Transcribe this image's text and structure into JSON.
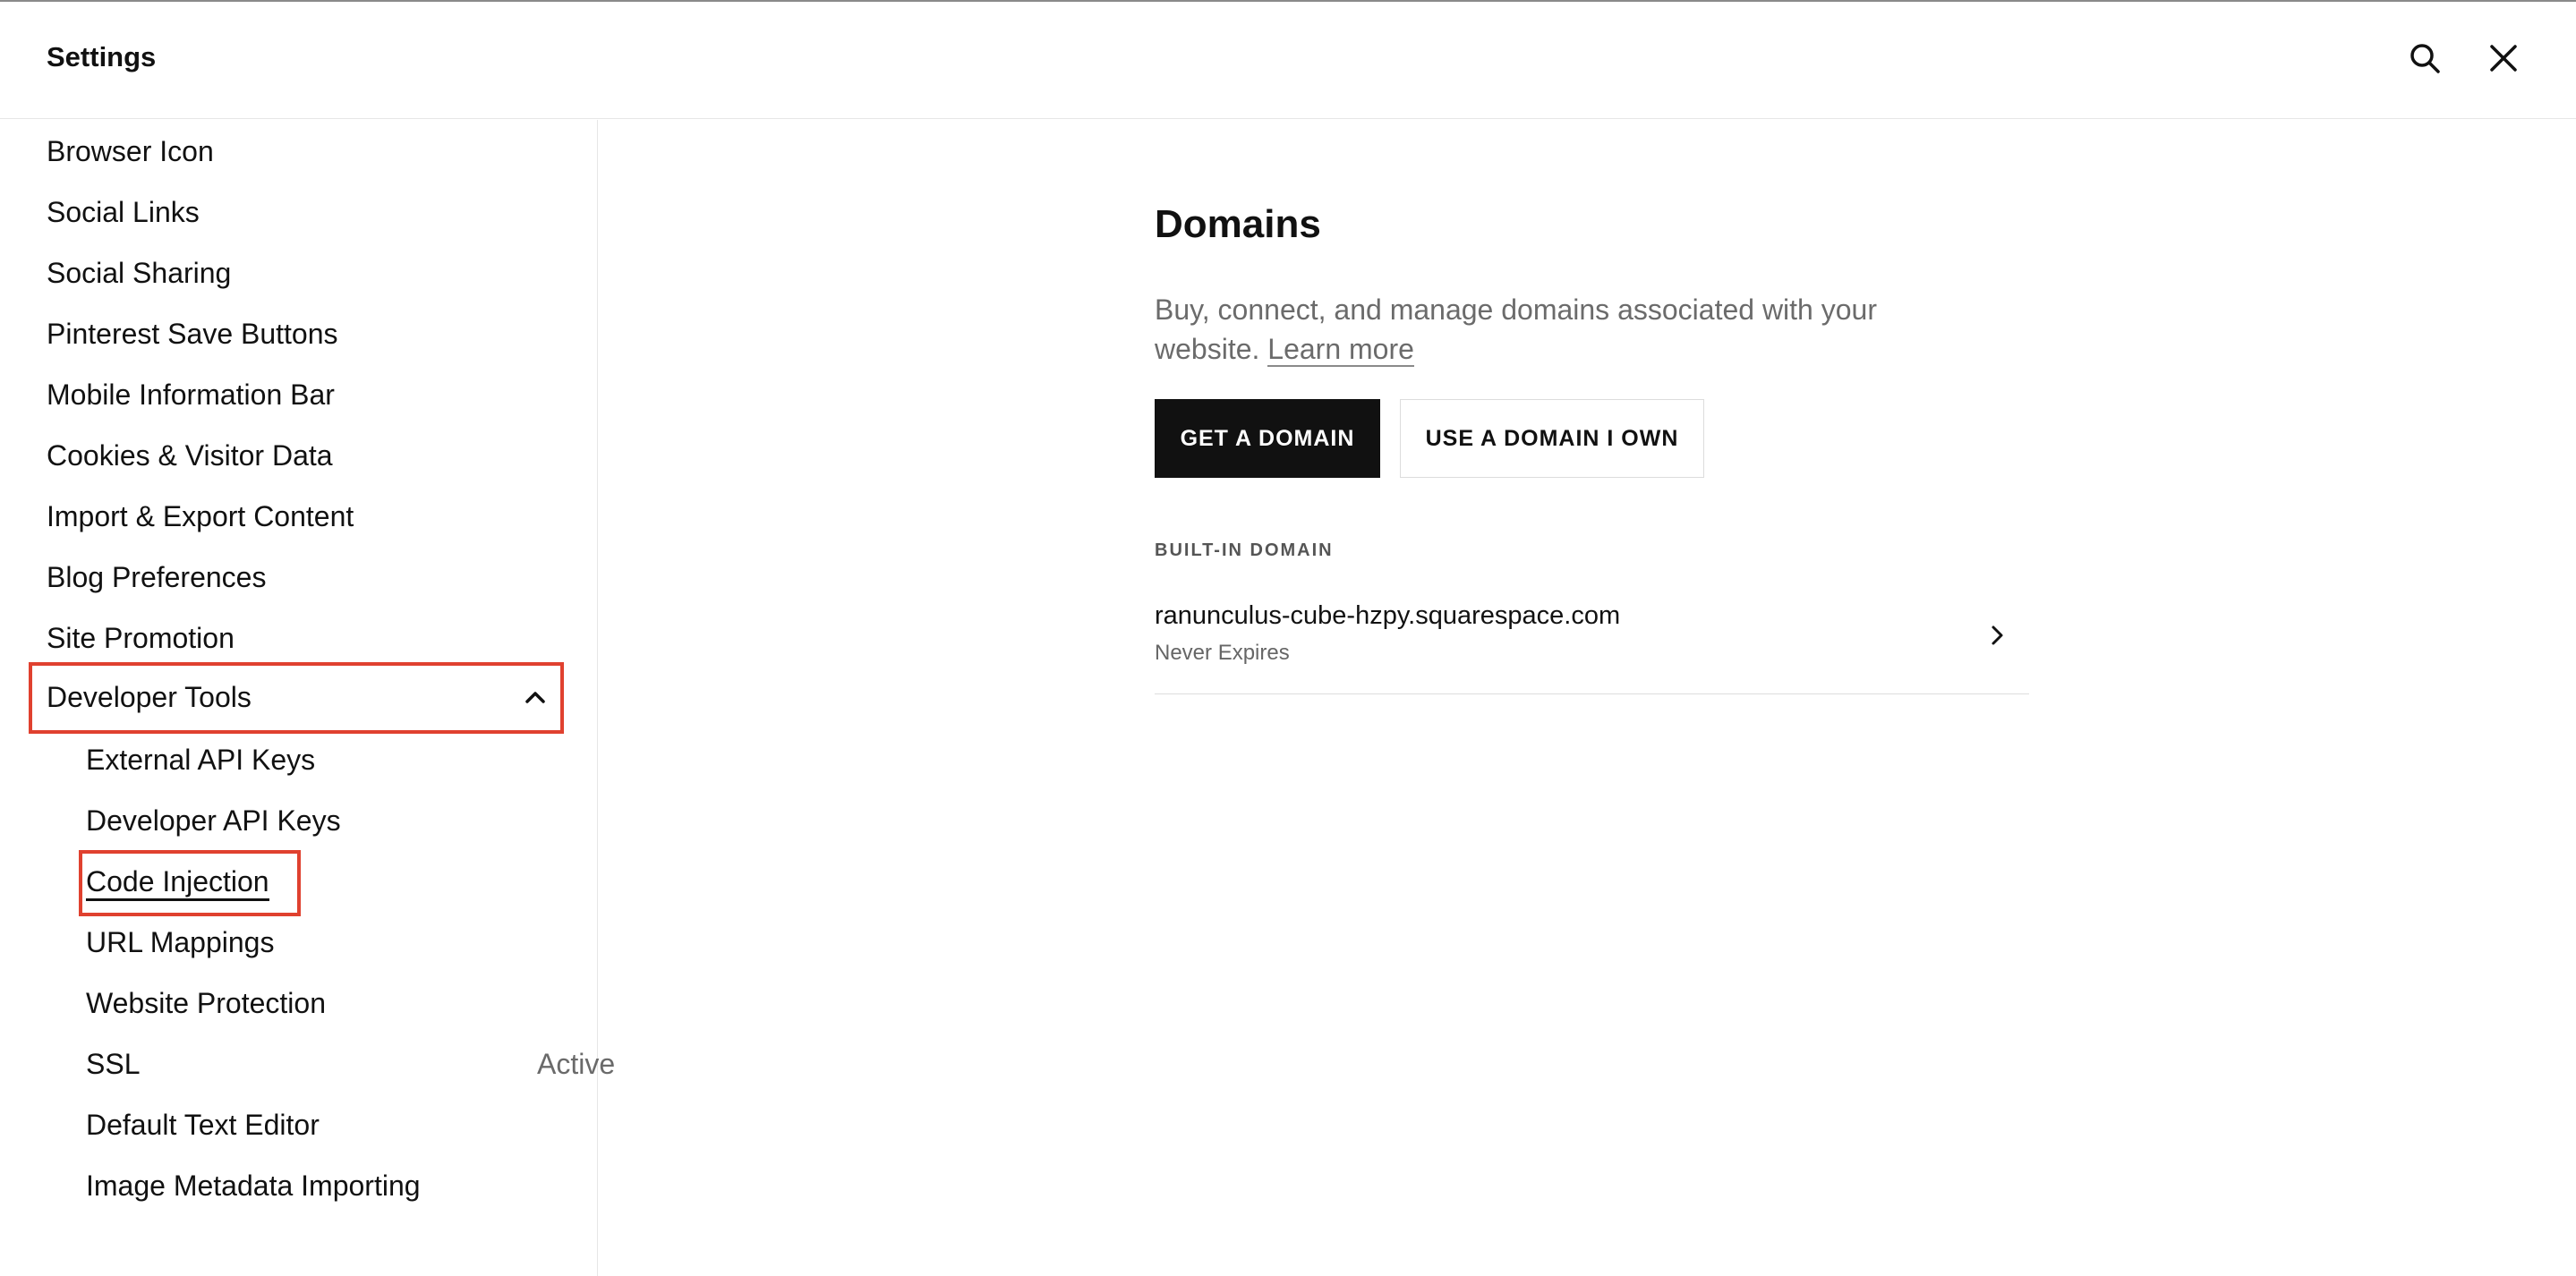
{
  "header": {
    "title": "Settings"
  },
  "icons": {
    "search": "search-icon",
    "close": "close-icon",
    "chevron_up": "chevron-up-icon",
    "chevron_right": "chevron-right-icon"
  },
  "sidebar": {
    "items": [
      {
        "label": "Browser Icon"
      },
      {
        "label": "Social Links"
      },
      {
        "label": "Social Sharing"
      },
      {
        "label": "Pinterest Save Buttons"
      },
      {
        "label": "Mobile Information Bar"
      },
      {
        "label": "Cookies & Visitor Data"
      },
      {
        "label": "Import & Export Content"
      },
      {
        "label": "Blog Preferences"
      },
      {
        "label": "Site Promotion"
      }
    ],
    "developer_tools": {
      "label": "Developer Tools",
      "expanded": true,
      "subitems": [
        {
          "label": "External API Keys"
        },
        {
          "label": "Developer API Keys"
        },
        {
          "label": "Code Injection"
        },
        {
          "label": "URL Mappings"
        },
        {
          "label": "Website Protection"
        },
        {
          "label": "SSL",
          "status": "Active"
        },
        {
          "label": "Default Text Editor"
        },
        {
          "label": "Image Metadata Importing"
        }
      ]
    }
  },
  "main": {
    "title": "Domains",
    "description": "Buy, connect, and manage domains associated with your website.",
    "learn_more": "Learn more",
    "primary_button": "GET A DOMAIN",
    "secondary_button": "USE A DOMAIN I OWN",
    "section_label": "BUILT-IN DOMAIN",
    "built_in_domain": {
      "name": "ranunculus-cube-hzpy.squarespace.com",
      "expiry": "Never Expires"
    }
  },
  "colors": {
    "highlight": "#e0412f",
    "primary_button_bg": "#111111"
  }
}
